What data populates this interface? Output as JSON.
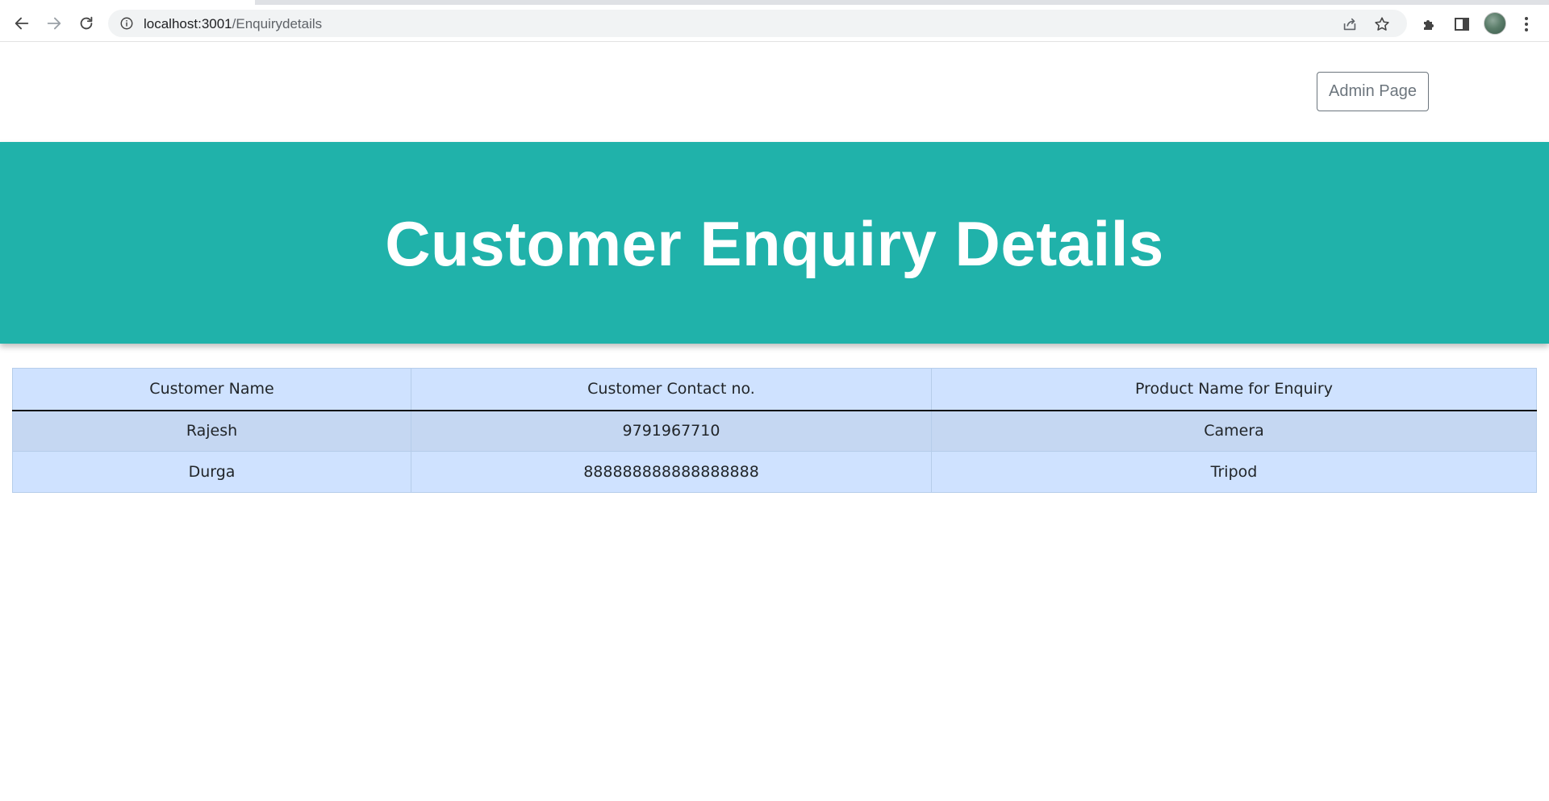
{
  "browser": {
    "url_host": "localhost:3001",
    "url_path": "/Enquirydetails",
    "icons": {
      "back": "back-arrow-icon",
      "forward": "forward-arrow-icon",
      "reload": "reload-icon",
      "site_info": "info-icon",
      "share": "share-icon",
      "bookmark": "star-icon",
      "extensions": "puzzle-icon",
      "side_panel": "side-panel-icon",
      "menu": "kebab-menu-icon"
    }
  },
  "header": {
    "admin_button_label": "Admin Page"
  },
  "banner": {
    "title": "Customer Enquiry Details",
    "background": "#20b2aa"
  },
  "table": {
    "columns": [
      "Customer Name",
      "Customer Contact no.",
      "Product Name for Enquiry"
    ],
    "rows": [
      [
        "Rajesh",
        "9791967710",
        "Camera"
      ],
      [
        "Durga",
        "888888888888888888",
        "Tripod"
      ]
    ]
  }
}
